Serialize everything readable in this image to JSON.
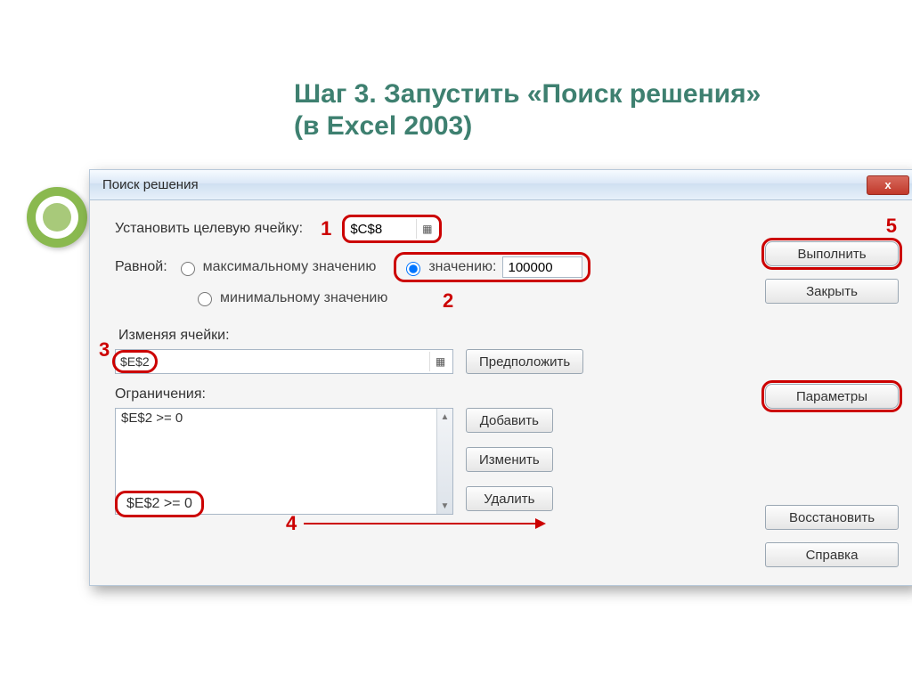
{
  "heading": "Шаг 3. Запустить  «Поиск решения» (в Excel 2003)",
  "dialog": {
    "title": "Поиск решения",
    "close_x": "x",
    "labels": {
      "target": "Установить целевую ячейку:",
      "equal": "Равной:",
      "max": "максимальному значению",
      "min": "минимальному значению",
      "value": "значению:",
      "changing": "Изменяя ячейки:",
      "constraints": "Ограничения:"
    },
    "values": {
      "target_cell": "$C$8",
      "target_value": "100000",
      "changing_cells": "$E$2",
      "constraint_item": "$E$2 >= 0"
    },
    "buttons": {
      "run": "Выполнить",
      "close": "Закрыть",
      "options": "Параметры",
      "restore": "Восстановить",
      "help": "Справка",
      "guess": "Предположить",
      "add": "Добавить",
      "change": "Изменить",
      "delete": "Удалить"
    },
    "steps": {
      "s1": "1",
      "s2": "2",
      "s3": "3",
      "s4": "4",
      "s5": "5"
    }
  }
}
